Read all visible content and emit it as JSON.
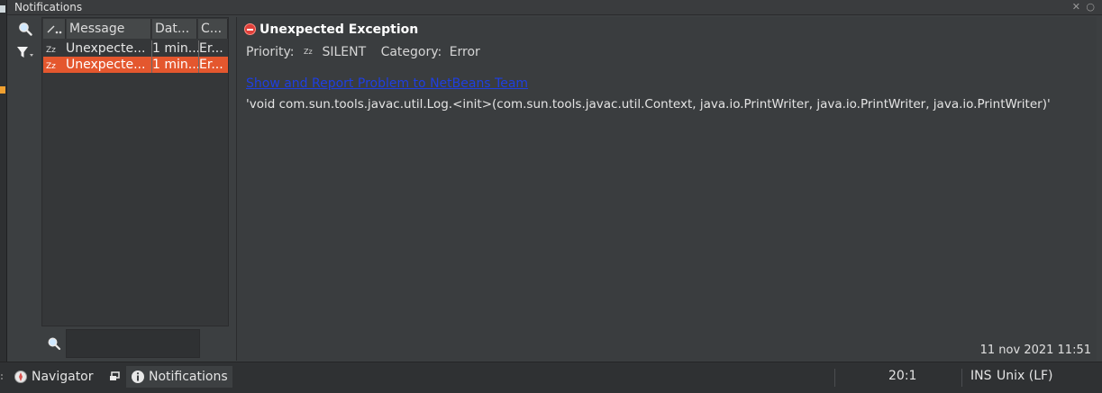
{
  "window": {
    "title": "Notifications"
  },
  "list": {
    "columns": [
      "Message",
      "Dat...",
      "C..."
    ],
    "rows": [
      {
        "message": "Unexpecte...",
        "date": "1 min...",
        "category": "Er..."
      },
      {
        "message": "Unexpecte...",
        "date": "1 min...",
        "category": "Er..."
      }
    ],
    "selected_index": 1
  },
  "search": {
    "value": "",
    "icon": "search-icon"
  },
  "detail": {
    "title": "Unexpected Exception",
    "priority_label": "Priority:",
    "priority_value": "SILENT",
    "category_label": "Category:",
    "category_value": "Error",
    "link_text": "Show and Report Problem to NetBeans Team",
    "message": "'void com.sun.tools.javac.util.Log.<init>(com.sun.tools.javac.util.Context, java.io.PrintWriter, java.io.PrintWriter, java.io.PrintWriter)'",
    "timestamp": "11 nov 2021 11:51"
  },
  "statusbar": {
    "navigator": "Navigator",
    "notifications": "Notifications",
    "position": "20:1",
    "mode": "INS",
    "line_ending": "Unix (LF)"
  },
  "colors": {
    "selection": "#e4572e",
    "link": "#1f3fe0",
    "background": "#3c3f41"
  }
}
